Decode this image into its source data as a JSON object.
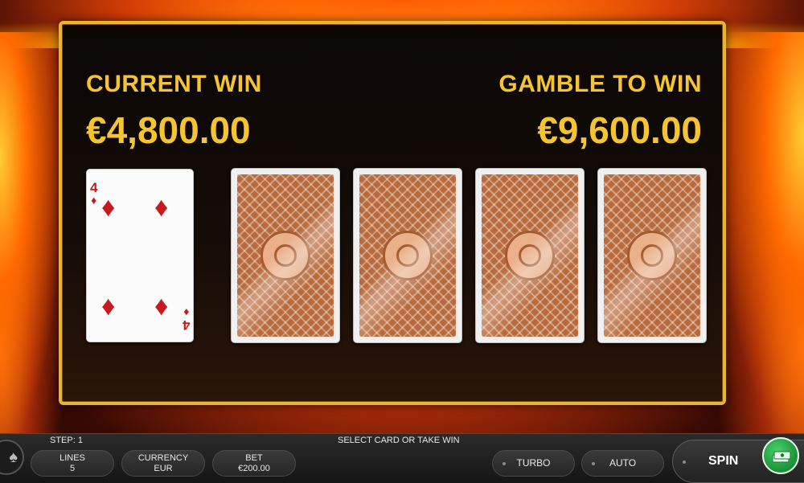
{
  "gamble": {
    "current_win_label": "CURRENT WIN",
    "current_win_amount": "€4,800.00",
    "gamble_to_win_label": "GAMBLE TO WIN",
    "gamble_to_win_amount": "€9,600.00"
  },
  "dealer_card": {
    "rank": "4",
    "suit": "♦",
    "suit_name": "diamonds",
    "suit_color": "#c8191c"
  },
  "card_backs": [
    {
      "name": "card-back-1"
    },
    {
      "name": "card-back-2"
    },
    {
      "name": "card-back-3"
    },
    {
      "name": "card-back-4"
    }
  ],
  "bottom_bar": {
    "step": "STEP: 1",
    "status": "SELECT CARD OR TAKE WIN",
    "lines_label": "LINES",
    "lines_value": "5",
    "currency_label": "CURRENCY",
    "currency_value": "EUR",
    "bet_label": "BET",
    "bet_value": "€200.00",
    "turbo_label": "TURBO",
    "auto_label": "AUTO",
    "spin_label": "SPIN"
  },
  "colors": {
    "gold": "#f5c531",
    "frame": "#e8b52c",
    "card_back": "#b86a3c",
    "collect_green": "#1f9a3d"
  },
  "icons": [
    "cards-deck-icon",
    "cash-collect-icon",
    "diamond-suit-icon",
    "card-back-emblem-icon"
  ]
}
